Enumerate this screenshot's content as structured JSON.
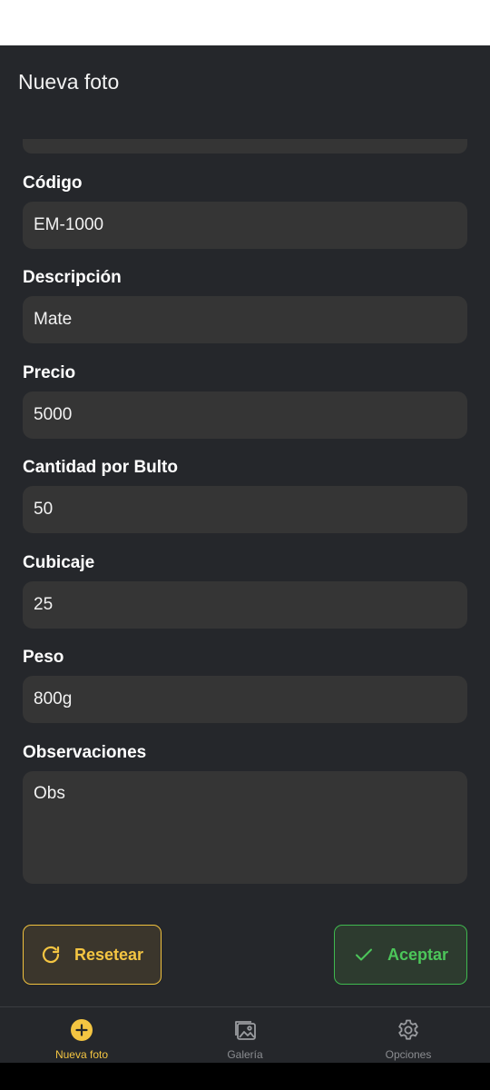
{
  "app": {
    "title": "Nueva foto",
    "accent_color": "#f4c542",
    "success_color": "#4cc65a",
    "background_color": "#25272b",
    "field_color": "#353535"
  },
  "form": {
    "fields": [
      {
        "label": "Código",
        "value": "EM-1000"
      },
      {
        "label": "Descripción",
        "value": "Mate"
      },
      {
        "label": "Precio",
        "value": "5000"
      },
      {
        "label": "Cantidad por Bulto",
        "value": "50"
      },
      {
        "label": "Cubicaje",
        "value": "25"
      },
      {
        "label": "Peso",
        "value": "800g"
      }
    ],
    "observations": {
      "label": "Observaciones",
      "value": "Obs"
    }
  },
  "actions": {
    "reset_label": "Resetear",
    "reset_icon": "refresh-icon",
    "accept_label": "Aceptar",
    "accept_icon": "check-icon"
  },
  "bottom_nav": {
    "items": [
      {
        "label": "Nueva foto",
        "icon": "add-circle-icon",
        "active": true
      },
      {
        "label": "Galería",
        "icon": "image-icon",
        "active": false
      },
      {
        "label": "Opciones",
        "icon": "gear-icon",
        "active": false
      }
    ]
  }
}
